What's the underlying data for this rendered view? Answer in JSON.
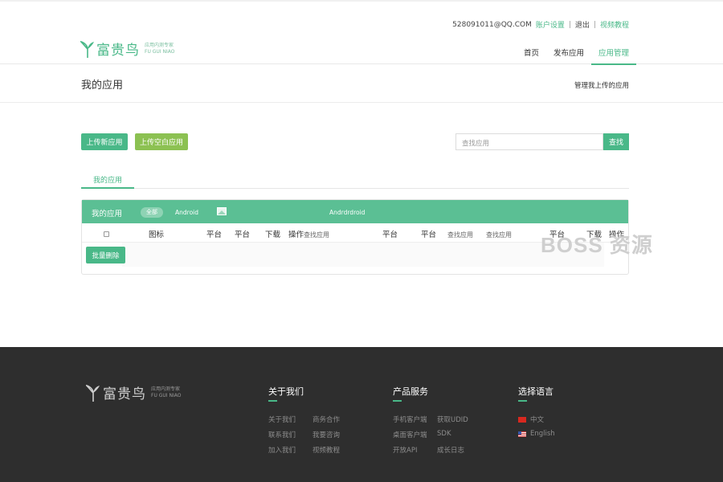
{
  "header": {
    "account": "528091011@QQ.COM",
    "account_settings": "账户设置",
    "logout": "退出",
    "video_tutorial": "视频教程",
    "separator": "|",
    "brand": "富贵鸟",
    "slogan_cn": "应用内测专家",
    "slogan_en": "FU GUI NIAO",
    "nav": [
      {
        "label": "首页",
        "active": false
      },
      {
        "label": "发布应用",
        "active": false
      },
      {
        "label": "应用管理",
        "active": true
      }
    ]
  },
  "titlebar": {
    "title": "我的应用",
    "description": "管理我上传的应用"
  },
  "actions": {
    "upload_new": "上传新应用",
    "upload_blank": "上传空白应用",
    "search_placeholder": "查找应用",
    "search_button": "查找"
  },
  "tabs": {
    "my_apps": "我的应用"
  },
  "panel": {
    "title": "我的应用",
    "filter_all": "全部",
    "filter_android": "Android",
    "filter_android2": "Andrdrdroid",
    "columns": [
      "图标",
      "平台",
      "平台",
      "下载",
      "操作",
      "查找应用",
      "平台",
      "平台",
      "查找应用",
      "查找应用",
      "平台",
      "下载",
      "操作"
    ],
    "batch_delete": "批量删除"
  },
  "watermark": "BOSS 资源",
  "footer": {
    "brand": "富贵鸟",
    "slogan_cn": "应用内测专家",
    "slogan_en": "FU GUI NIAO",
    "about_title": "关于我们",
    "about_links": [
      "关于我们",
      "商务合作",
      "联系我们",
      "我要咨询",
      "加入我们",
      "视频教程"
    ],
    "product_title": "产品服务",
    "product_links": [
      "手机客户端",
      "获取UDID",
      "桌面客户端",
      "SDK",
      "开放API",
      "成长日志"
    ],
    "language_title": "选择语言",
    "languages": [
      "中文",
      "English"
    ]
  },
  "colors": {
    "accent": "#49b888",
    "accent_light": "#5bbf94",
    "lime": "#8cc152",
    "footer_bg": "#2e2e2e"
  }
}
